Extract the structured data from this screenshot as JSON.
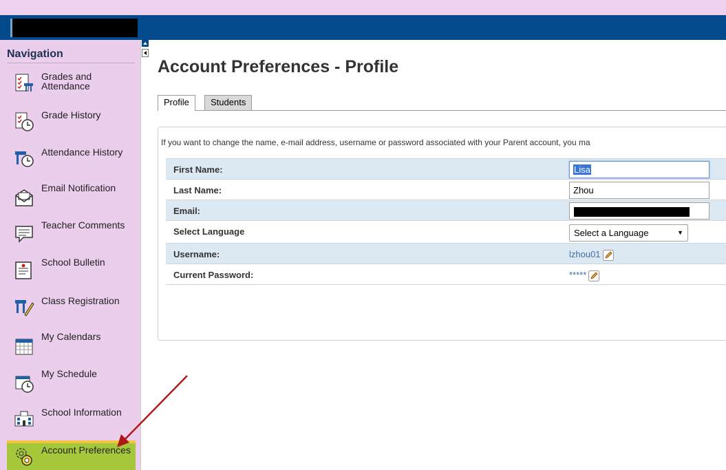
{
  "nav": {
    "title": "Navigation",
    "items": [
      {
        "label": "Grades and Attendance",
        "icon": "grades-icon"
      },
      {
        "label": "Grade History",
        "icon": "grade-history-icon"
      },
      {
        "label": "Attendance History",
        "icon": "attendance-history-icon"
      },
      {
        "label": "Email Notification",
        "icon": "email-icon"
      },
      {
        "label": "Teacher Comments",
        "icon": "comments-icon"
      },
      {
        "label": "School Bulletin",
        "icon": "bulletin-icon"
      },
      {
        "label": "Class Registration",
        "icon": "registration-icon"
      },
      {
        "label": "My Calendars",
        "icon": "calendar-icon"
      },
      {
        "label": "My Schedule",
        "icon": "schedule-icon"
      },
      {
        "label": "School Information",
        "icon": "school-icon"
      },
      {
        "label": "Account Preferences",
        "icon": "gears-icon"
      }
    ]
  },
  "page": {
    "title": "Account Preferences - Profile",
    "tabs": [
      {
        "label": "Profile"
      },
      {
        "label": "Students"
      }
    ],
    "intro": "If you want to change the name, e-mail address, username or password associated with your Parent account, you ma"
  },
  "form": {
    "first_name_label": "First Name:",
    "first_name_value": "Lisa",
    "last_name_label": "Last Name:",
    "last_name_value": "Zhou",
    "email_label": "Email:",
    "language_label": "Select Language",
    "language_value": "Select a Language",
    "username_label": "Username:",
    "username_value": "lzhou01",
    "password_label": "Current Password:",
    "password_value": "*****"
  },
  "colors": {
    "header": "#034a8d",
    "sidebar": "#ebcdec",
    "active_item": "#a5c83a",
    "link": "#3d6fa5",
    "row_alt": "#dde9f2"
  }
}
